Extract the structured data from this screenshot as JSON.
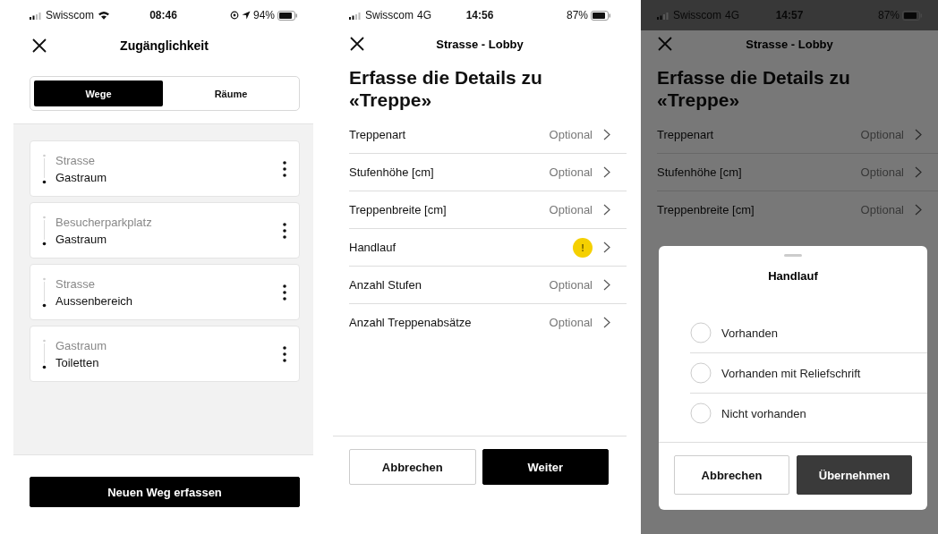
{
  "screens": [
    {
      "kind": "route_list",
      "status_bar": {
        "carrier": "Swisscom",
        "wifi": true,
        "time": "08:46",
        "location": true,
        "battery": "94%"
      },
      "title": "Zugänglichkeit",
      "tabs": [
        {
          "label": "Wege",
          "selected": true
        },
        {
          "label": "Räume",
          "selected": false
        }
      ],
      "routes": [
        {
          "from": "Strasse",
          "to": "Gastraum"
        },
        {
          "from": "Besucherparkplatz",
          "to": "Gastraum"
        },
        {
          "from": "Strasse",
          "to": "Aussenbereich"
        },
        {
          "from": "Gastraum",
          "to": "Toiletten"
        }
      ],
      "primary_button": "Neuen Weg erfassen"
    },
    {
      "kind": "form",
      "status_bar": {
        "carrier": "Swisscom",
        "network": "4G",
        "time": "14:56",
        "battery": "87%"
      },
      "title": "Strasse - Lobby",
      "heading": "Erfasse die Details zu «Treppe»",
      "fields": [
        {
          "label": "Treppenart",
          "kind": "optional",
          "value": "Optional"
        },
        {
          "label": "Stufenhöhe [cm]",
          "kind": "optional",
          "value": "Optional"
        },
        {
          "label": "Treppenbreite [cm]",
          "kind": "optional",
          "value": "Optional"
        },
        {
          "label": "Handlauf",
          "kind": "warning",
          "badge": "!"
        },
        {
          "label": "Anzahl Stufen",
          "kind": "optional",
          "value": "Optional"
        },
        {
          "label": "Anzahl Treppenabsätze",
          "kind": "optional",
          "value": "Optional"
        }
      ],
      "buttons": [
        {
          "label": "Abbrechen",
          "kind": "secondary"
        },
        {
          "label": "Weiter",
          "kind": "primary"
        }
      ]
    },
    {
      "kind": "form_with_sheet",
      "status_bar": {
        "carrier": "Swisscom",
        "network": "4G",
        "time": "14:57",
        "battery": "87%"
      },
      "title": "Strasse - Lobby",
      "heading": "Erfasse die Details zu «Treppe»",
      "fields": [
        {
          "label": "Treppenart",
          "kind": "optional",
          "value": "Optional"
        },
        {
          "label": "Stufenhöhe [cm]",
          "kind": "optional",
          "value": "Optional"
        },
        {
          "label": "Treppenbreite [cm]",
          "kind": "optional",
          "value": "Optional"
        }
      ],
      "sheet": {
        "title": "Handlauf",
        "options": [
          {
            "label": "Vorhanden",
            "selected": false
          },
          {
            "label": "Vorhanden mit Reliefschrift",
            "selected": false
          },
          {
            "label": "Nicht vorhanden",
            "selected": false
          }
        ],
        "buttons": [
          {
            "label": "Abbrechen",
            "kind": "secondary"
          },
          {
            "label": "Übernehmen",
            "kind": "primary"
          }
        ]
      }
    }
  ]
}
